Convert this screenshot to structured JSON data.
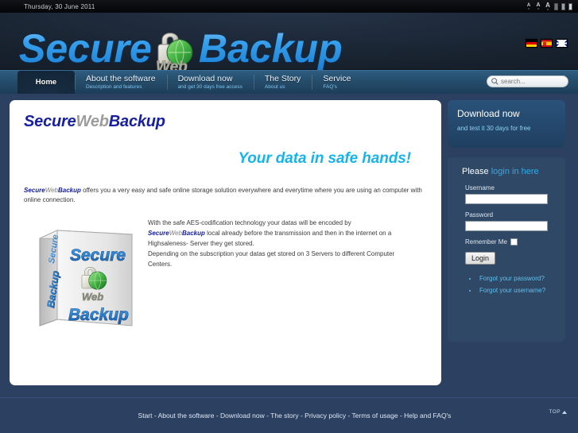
{
  "topbar": {
    "date": "Thursday, 30 June 2011",
    "tools": [
      {
        "name": "font-size-decrease-icon",
        "glyph": "A",
        "sub": "v"
      },
      {
        "name": "font-size-normal-icon",
        "glyph": "A",
        "sub": "v"
      },
      {
        "name": "font-size-increase-icon",
        "glyph": "A",
        "sub": "v"
      },
      {
        "name": "color-scheme-dark-icon",
        "glyph": "",
        "sub": ""
      },
      {
        "name": "color-scheme-medium-icon",
        "glyph": "",
        "sub": ""
      },
      {
        "name": "color-scheme-light-icon",
        "glyph": "",
        "sub": ""
      }
    ]
  },
  "header": {
    "logo_secure": "Secure",
    "logo_web": "Web",
    "logo_backup": "Backup",
    "flags": [
      {
        "name": "flag-de",
        "label": "Deutsch"
      },
      {
        "name": "flag-es",
        "label": "Espanol"
      },
      {
        "name": "flag-gb",
        "label": "English"
      }
    ]
  },
  "nav": {
    "items": [
      {
        "title": "Home",
        "sub": "",
        "active": true
      },
      {
        "title": "About the software",
        "sub": "Description and features",
        "active": false
      },
      {
        "title": "Download now",
        "sub": "and get 30 days free access",
        "active": false
      },
      {
        "title": "The Story",
        "sub": "About us",
        "active": false
      },
      {
        "title": "Service",
        "sub": "FAQ's",
        "active": false
      }
    ],
    "search": {
      "placeholder": "search...",
      "value": ""
    }
  },
  "content": {
    "brand": {
      "secure": "Secure",
      "web": "Web",
      "backup": "Backup"
    },
    "tagline": "Your data in safe hands!",
    "intro_tail": " offers you a very easy and safe online storage solution everywhere and everytime where you are using an computer with online connection.",
    "para_line1": "With the safe AES-codification technology your datas will be encoded by",
    "para_line2_tail": " local already before the transmission and then in the internet on a",
    "para_line3": "Highsaleness- Server they get stored.",
    "para_line4": "Depending on the subscription your datas get stored on 3 Servers to different Computer",
    "para_line5": "Centers.",
    "boxshot": {
      "secure": "Secure",
      "web": "Web",
      "backup": "Backup"
    }
  },
  "sidebar": {
    "promo": {
      "title": "Download now",
      "sub": "and test it 30 days for free"
    },
    "login": {
      "head_white": "Please ",
      "head_accent": "login in here",
      "username_label": "Username",
      "username_value": "",
      "password_label": "Password",
      "password_value": "",
      "remember_label": "Remember Me",
      "remember_checked": false,
      "login_button": "Login",
      "links": [
        "Forgot your password?",
        "Forgot your username?"
      ]
    }
  },
  "footer": {
    "links": "Start - About the software - Download now - The story - Privacy policy - Terms of usage - Help and FAQ's",
    "top_label": "TOP"
  },
  "colors": {
    "page_bg": "#2c4162",
    "nav_blue": "#27506f",
    "accent_cyan": "#17b4ec",
    "brand_blue": "#17209e",
    "brand_grey": "#9c9c9c",
    "link_blue": "#5fc2ef"
  }
}
